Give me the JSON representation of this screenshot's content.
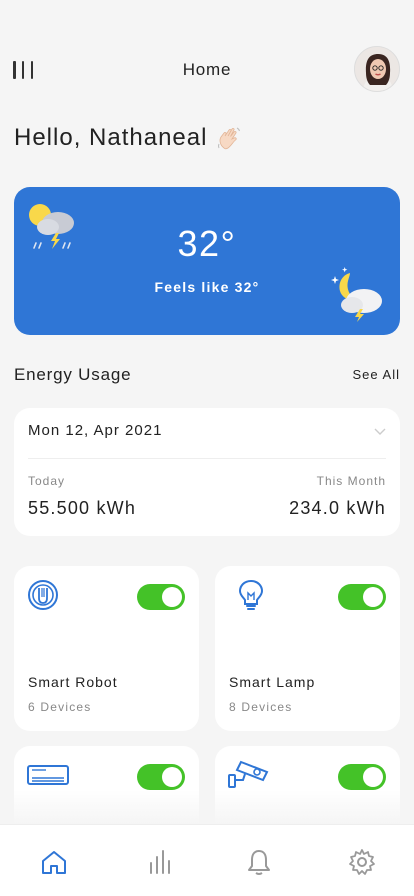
{
  "header": {
    "title": "Home"
  },
  "greeting": {
    "text": "Hello, Nathaneal"
  },
  "weather": {
    "temperature": "32°",
    "feels_like": "Feels like 32°"
  },
  "energy": {
    "section_title": "Energy Usage",
    "see_all": "See All",
    "date": "Mon 12, Apr 2021",
    "today_label": "Today",
    "today_value": "55.500 kWh",
    "month_label": "This Month",
    "month_value": "234.0 kWh"
  },
  "devices": [
    {
      "name": "Smart Robot",
      "count": "6 Devices",
      "icon": "robot-icon",
      "on": true
    },
    {
      "name": "Smart Lamp",
      "count": "8 Devices",
      "icon": "lamp-icon",
      "on": true
    },
    {
      "name": "",
      "count": "",
      "icon": "air-conditioner-icon",
      "on": true
    },
    {
      "name": "",
      "count": "",
      "icon": "cctv-camera-icon",
      "on": true
    }
  ],
  "tabs": [
    {
      "icon": "home-icon",
      "active": true
    },
    {
      "icon": "stats-icon",
      "active": false
    },
    {
      "icon": "bell-icon",
      "active": false
    },
    {
      "icon": "gear-icon",
      "active": false
    }
  ],
  "colors": {
    "accent": "#2f76d6",
    "toggle_on": "#44c228",
    "background": "#f5f5f5"
  }
}
